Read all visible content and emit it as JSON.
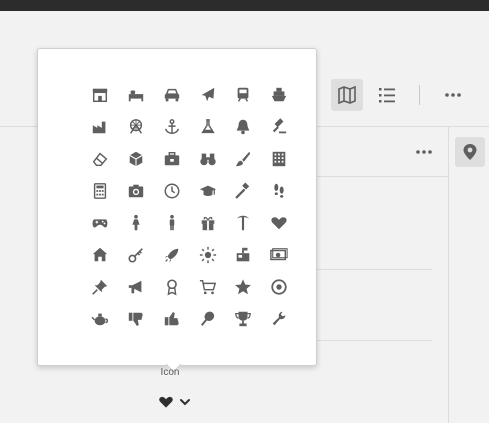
{
  "colors": {
    "icon": "#5f5f5f",
    "topbar": "#2c2c2c",
    "popover_bg": "#ffffff"
  },
  "toolbar": {
    "map_view_icon": "map-icon",
    "list_view_icon": "list-icon",
    "more_icon": "more-horizontal-icon"
  },
  "panel": {
    "more_icon": "more-horizontal-icon",
    "rail_icon": "location-pin-icon"
  },
  "icon_picker": {
    "label": "Icon",
    "selected_icon": "heart-icon",
    "dropdown_icon": "chevron-down-icon",
    "icons": [
      "store-icon",
      "bed-icon",
      "car-icon",
      "airplane-icon",
      "train-icon",
      "ship-icon",
      "factory-icon",
      "amusement-park-icon",
      "anchor-icon",
      "flask-icon",
      "bell-icon",
      "gavel-icon",
      "eraser-icon",
      "cube-icon",
      "briefcase-icon",
      "binoculars-icon",
      "paintbrush-icon",
      "building-icon",
      "calculator-icon",
      "camera-icon",
      "clock-icon",
      "graduation-cap-icon",
      "hammer-icon",
      "footprints-icon",
      "gamepad-icon",
      "woman-icon",
      "man-icon",
      "gift-icon",
      "pickaxe-icon",
      "heart-icon",
      "home-icon",
      "key-icon",
      "rocket-icon",
      "sun-icon",
      "mailbox-icon",
      "money-icon",
      "pushpin-icon",
      "megaphone-icon",
      "award-icon",
      "shopping-cart-icon",
      "star-icon",
      "target-icon",
      "teapot-icon",
      "thumbs-down-icon",
      "thumbs-up-icon",
      "tennis-racket-icon",
      "trophy-icon",
      "wrench-icon"
    ]
  }
}
